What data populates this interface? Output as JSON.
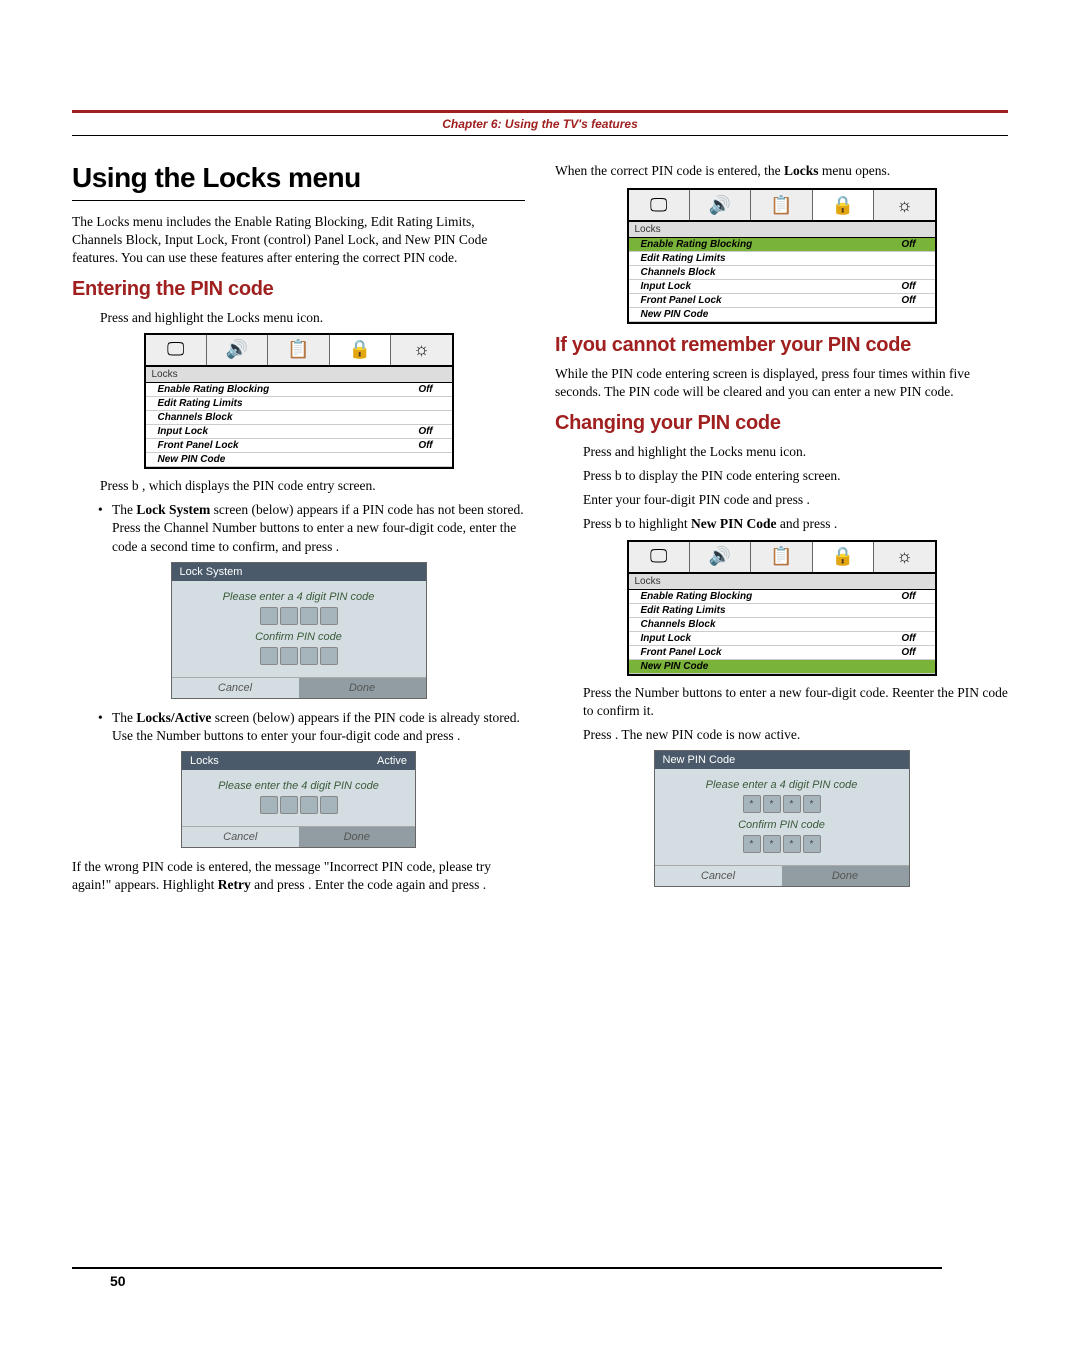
{
  "chapter": "Chapter 6: Using the TV's features",
  "h1": "Using the Locks menu",
  "intro": "The Locks menu includes the Enable Rating Blocking, Edit Rating Limits, Channels Block, Input Lock, Front (control) Panel Lock, and New PIN Code features. You can use these features after entering the correct PIN code.",
  "h2_enter": "Entering the PIN code",
  "step_a": "Press        and highlight the Locks  menu icon.",
  "step_b": "Press  b , which displays the PIN code entry screen.",
  "bullet_1a": "The ",
  "bullet_1b": "Lock System",
  "bullet_1c": "  screen (below) appears if a PIN code has not been stored. Press the Channel Number buttons to enter a new four-digit code, enter the code a second time to confirm, and press       .",
  "bullet_2a": "The ",
  "bullet_2b": "Locks/Active",
  "bullet_2c": "  screen (below) appears if the PIN code is already stored. Use the Number buttons to enter your four-digit code and press       .",
  "wrong_a": "If the wrong PIN code is entered, the message \"Incorrect PIN code, please try again!\" appears. Highlight ",
  "wrong_b": "Retry",
  "wrong_c": " and press      . Enter the code again and press       .",
  "right_a": "When the correct PIN code is entered, the ",
  "right_b": "Locks",
  "right_c": "  menu opens.",
  "h2_forgot": "If you cannot remember your PIN code",
  "forgot_body": "While the PIN code entering screen is displayed, press       four times within five seconds. The PIN code will be cleared and you can enter a new PIN code.",
  "h2_change": "Changing your PIN code",
  "ch_step1": "Press       and highlight the Locks  menu icon.",
  "ch_step2": "Press  b  to display the PIN code entering screen.",
  "ch_step3": "Enter your four-digit PIN code and press       .",
  "ch_step4a": "Press  b  to highlight ",
  "ch_step4b": "New PIN Code",
  "ch_step4c": "  and press       .",
  "ch_step5": "Press the Number buttons to enter a new four-digit code. Reenter the PIN code to confirm it.",
  "ch_step6": "Press      . The new PIN code is now active.",
  "menu": {
    "title": "Locks",
    "rows": [
      {
        "label": "Enable Rating Blocking",
        "value": "Off"
      },
      {
        "label": "Edit Rating Limits",
        "value": ""
      },
      {
        "label": "Channels Block",
        "value": ""
      },
      {
        "label": "Input Lock",
        "value": "Off"
      },
      {
        "label": "Front Panel Lock",
        "value": "Off"
      },
      {
        "label": "New PIN Code",
        "value": ""
      }
    ]
  },
  "menu_hl_first": {
    "title": "Locks",
    "rows": [
      {
        "label": "Enable Rating Blocking",
        "value": "Off",
        "hl": true
      },
      {
        "label": "Edit Rating Limits",
        "value": ""
      },
      {
        "label": "Channels Block",
        "value": ""
      },
      {
        "label": "Input Lock",
        "value": "Off"
      },
      {
        "label": "Front Panel Lock",
        "value": "Off"
      },
      {
        "label": "New PIN Code",
        "value": ""
      }
    ]
  },
  "menu_hl_last": {
    "title": "Locks",
    "rows": [
      {
        "label": "Enable Rating Blocking",
        "value": "Off"
      },
      {
        "label": "Edit Rating Limits",
        "value": ""
      },
      {
        "label": "Channels Block",
        "value": ""
      },
      {
        "label": "Input Lock",
        "value": "Off"
      },
      {
        "label": "Front Panel Lock",
        "value": "Off"
      },
      {
        "label": "New PIN Code",
        "value": "",
        "hl": true
      }
    ]
  },
  "dlg_locksystem": {
    "title": "Lock System",
    "p1": "Please enter a 4 digit PIN code",
    "p2": "Confirm PIN code",
    "cancel": "Cancel",
    "done": "Done"
  },
  "dlg_locksactive": {
    "title_left": "Locks",
    "title_right": "Active",
    "p1": "Please enter the 4 digit PIN code",
    "cancel": "Cancel",
    "done": "Done"
  },
  "dlg_newpin": {
    "title": "New PIN Code",
    "p1": "Please enter a 4 digit PIN code",
    "p2": "Confirm PIN code",
    "cancel": "Cancel",
    "done": "Done"
  },
  "page_number": "50",
  "icons": {
    "picture": "🖵",
    "audio": "🔊",
    "setup": "📋",
    "locks": "🔒",
    "prefs": "☼"
  }
}
